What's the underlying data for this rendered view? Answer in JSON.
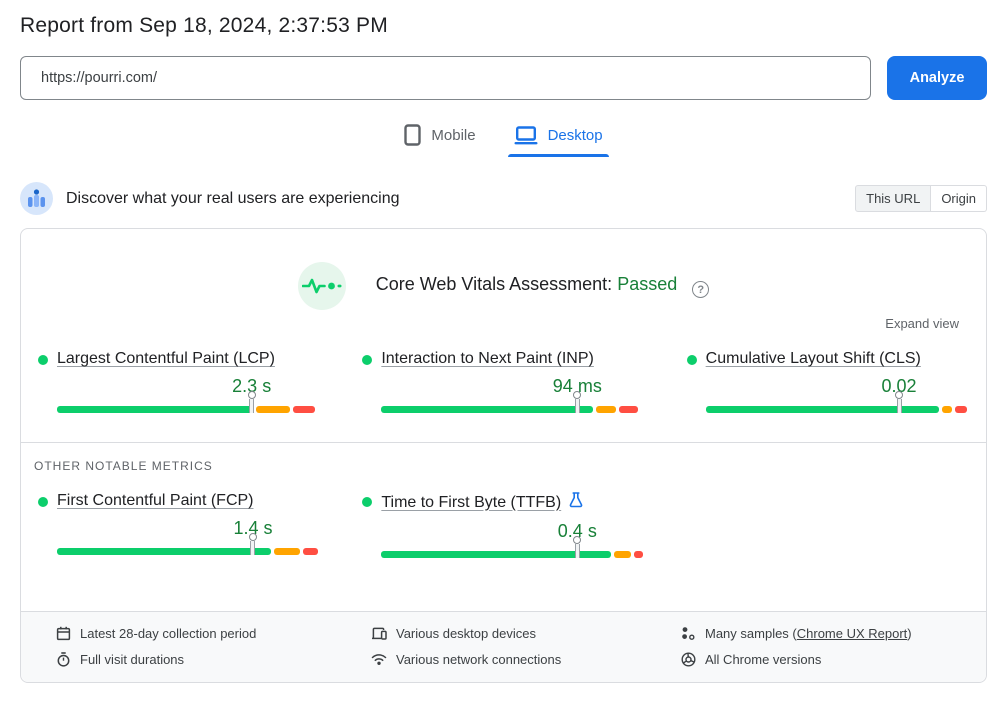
{
  "report": {
    "title": "Report from Sep 18, 2024, 2:37:53 PM"
  },
  "url_form": {
    "url_value": "https://pourri.com/",
    "analyze_button": "Analyze"
  },
  "device_tabs": {
    "mobile": "Mobile",
    "desktop": "Desktop"
  },
  "field_header": {
    "title": "Discover what your real users are experiencing",
    "this_url": "This URL",
    "origin": "Origin"
  },
  "assessment": {
    "label": "Core Web Vitals Assessment:",
    "result": "Passed",
    "expand": "Expand view",
    "other_metrics_label": "OTHER NOTABLE METRICS"
  },
  "metrics": {
    "core": [
      {
        "name": "Largest Contentful Paint (LCP)",
        "value": "2.3 s",
        "good_pct": 75,
        "ni_pct": 13,
        "poor_pct": 8.5,
        "marker_pct": 74.5
      },
      {
        "name": "Interaction to Next Paint (INP)",
        "value": "94 ms",
        "good_pct": 81,
        "ni_pct": 7.5,
        "poor_pct": 7.5,
        "marker_pct": 75
      },
      {
        "name": "Cumulative Layout Shift (CLS)",
        "value": "0.02",
        "good_pct": 90,
        "ni_pct": 4,
        "poor_pct": 4.5,
        "marker_pct": 74
      }
    ],
    "other": [
      {
        "name": "First Contentful Paint (FCP)",
        "value": "1.4 s",
        "good_pct": 82,
        "ni_pct": 10,
        "poor_pct": 5.5,
        "marker_pct": 75
      },
      {
        "name": "Time to First Byte (TTFB)",
        "value": "0.4 s",
        "good_pct": 88,
        "ni_pct": 6.5,
        "poor_pct": 3.5,
        "marker_pct": 75
      }
    ]
  },
  "collection_info": {
    "period": "Latest 28-day collection period",
    "durations": "Full visit durations",
    "devices": "Various desktop devices",
    "connections": "Various network connections",
    "samples_prefix": "Many samples (",
    "samples_link": "Chrome UX Report",
    "samples_suffix": ")",
    "versions": "All Chrome versions"
  },
  "colors": {
    "good": "#0cce6b",
    "needs_improvement": "#ffa400",
    "poor": "#ff4e42",
    "accent_blue": "#1a73e8",
    "passed_green": "#188038"
  }
}
